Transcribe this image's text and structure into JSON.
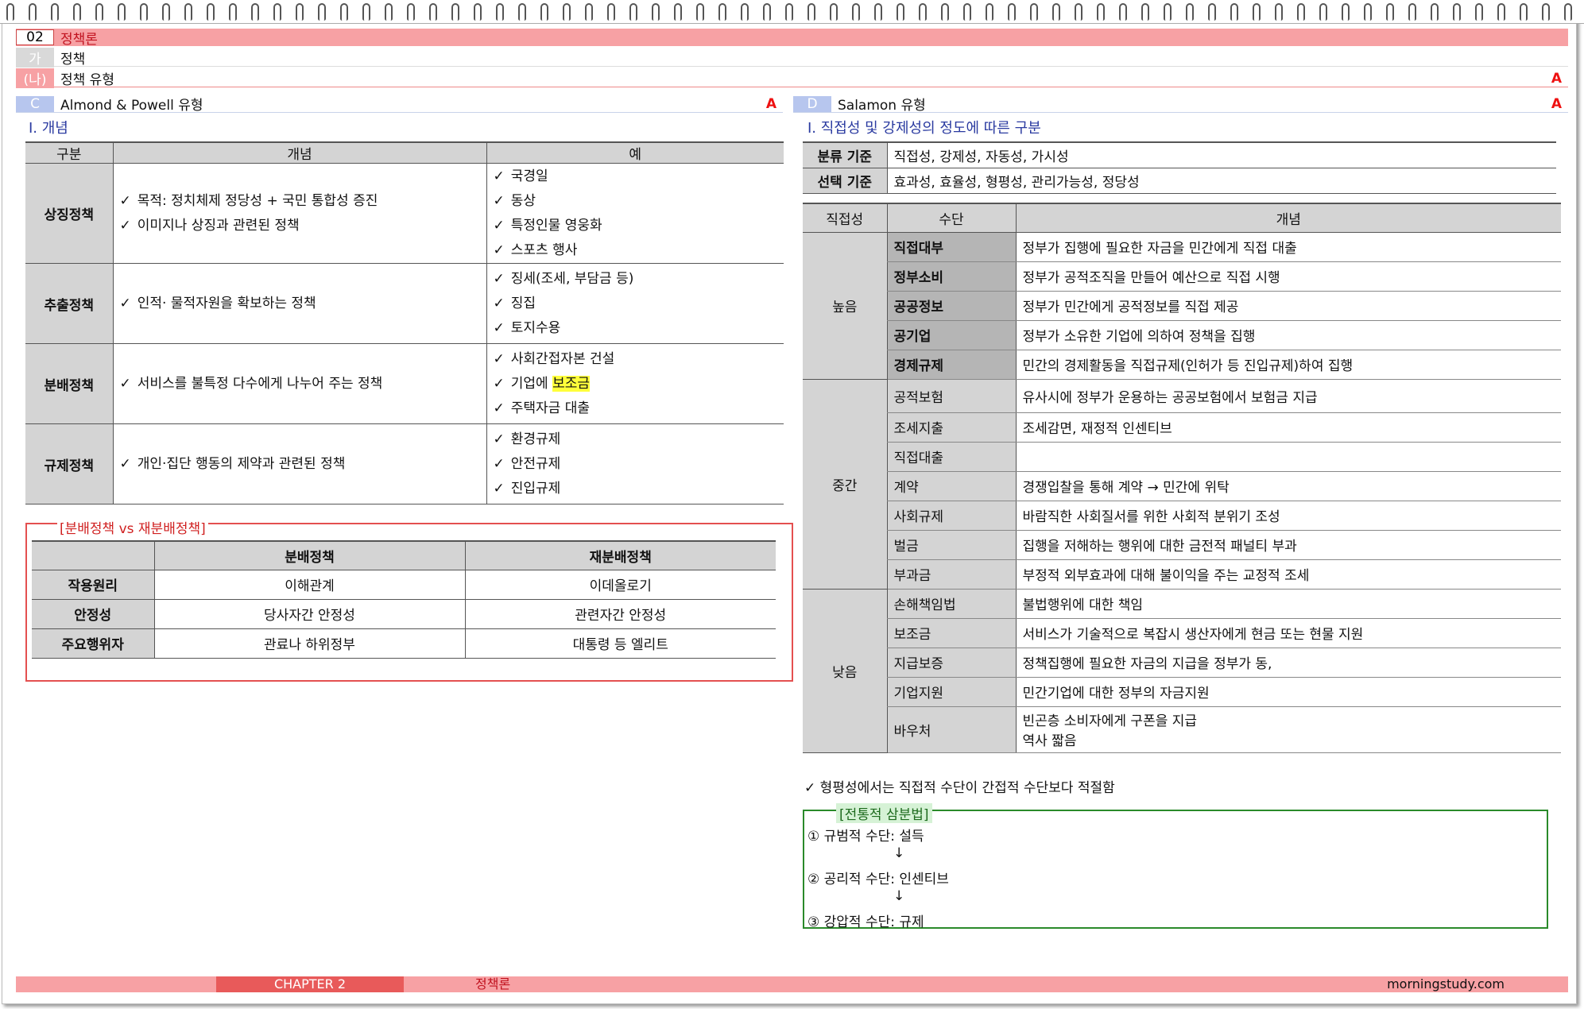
{
  "header": {
    "chapter_num": "02",
    "chapter_title": "정책론",
    "section_tag": "가",
    "section_title": "정책",
    "subsection_tag": "(나)",
    "subsection_title": "정책 유형",
    "subsection_grade": "A"
  },
  "left": {
    "tag": "C",
    "title": "Almond & Powell 유형",
    "grade": "A",
    "heading": "Ⅰ. 개념",
    "table": {
      "headers": [
        "구분",
        "개념",
        "예"
      ],
      "rows": [
        {
          "label": "상징정책",
          "concept": [
            "목적: 정치체제 정당성 + 국민 통합성 증진",
            "이미지나 상징과 관련된 정책"
          ],
          "examples": [
            "국경일",
            "동상",
            "특정인물 영웅화",
            "스포츠 행사"
          ]
        },
        {
          "label": "추출정책",
          "concept": [
            "인적· 물적자원을 확보하는 정책"
          ],
          "examples": [
            "징세(조세, 부담금 등)",
            "징집",
            "토지수용"
          ]
        },
        {
          "label": "분배정책",
          "concept": [
            "서비스를 불특정 다수에게 나누어 주는 정책"
          ],
          "examples": [
            "사회간접자본 건설",
            "기업에",
            "보조금",
            "주택자금 대출"
          ]
        },
        {
          "label": "규제정책",
          "concept": [
            "개인·집단 행동의 제약과 관련된 정책"
          ],
          "examples": [
            "환경규제",
            "안전규제",
            "진입규제"
          ]
        }
      ]
    },
    "compare": {
      "title": "[분배정책 vs 재분배정책]",
      "headers": [
        "",
        "분배정책",
        "재분배정책"
      ],
      "rows": [
        {
          "label": "작용원리",
          "a": "이해관계",
          "b": "이데올로기"
        },
        {
          "label": "안정성",
          "a": "당사자간 안정성",
          "b": "관련자간 안정성"
        },
        {
          "label": "주요행위자",
          "a": "관료나 하위정부",
          "b": "대통령 등 엘리트"
        }
      ]
    }
  },
  "right": {
    "tag": "D",
    "title": "Salamon 유형",
    "grade": "A",
    "heading": "Ⅰ. 직접성 및 강제성의 정도에 따른 구분",
    "criteria": [
      {
        "label": "분류 기준",
        "value": "직접성, 강제성, 자동성, 가시성"
      },
      {
        "label": "선택 기준",
        "value": "효과성, 효율성, 형평성, 관리가능성, 정당성"
      }
    ],
    "table": {
      "headers": [
        "직접성",
        "수단",
        "개념"
      ],
      "groups": [
        {
          "label": "높음",
          "rows": [
            {
              "means": "직접대부",
              "concept": "정부가 집행에 필요한 자금을 민간에게 직접 대출"
            },
            {
              "means": "정부소비",
              "concept": "정부가 공적조직을 만들어 예산으로 직접 시행"
            },
            {
              "means": "공공정보",
              "concept": "정부가 민간에게 공적정보를 직접 제공"
            },
            {
              "means": "공기업",
              "concept": "정부가 소유한 기업에 의하여 정책을 집행"
            },
            {
              "means": "경제규제",
              "concept": "민간의 경제활동을 직접규제(인허가 등 진입규제)하여 집행"
            }
          ]
        },
        {
          "label": "중간",
          "rows": [
            {
              "means": "공적보험",
              "concept": "유사시에 정부가 운용하는 공공보험에서 보험금 지급"
            },
            {
              "means": "조세지출",
              "concept": "조세감면, 재정적 인센티브"
            },
            {
              "means": "직접대출",
              "concept": ""
            },
            {
              "means": "계약",
              "concept": "경쟁입찰을 통해 계약 → 민간에 위탁"
            },
            {
              "means": "사회규제",
              "concept": "바람직한 사회질서를 위한 사회적 분위기 조성"
            },
            {
              "means": "벌금",
              "concept": "집행을 저해하는 행위에 대한 금전적 패널티 부과"
            },
            {
              "means": "부과금",
              "concept": "부정적 외부효과에 대해 불이익을 주는 교정적 조세"
            }
          ]
        },
        {
          "label": "낮음",
          "rows": [
            {
              "means": "손해책임법",
              "concept": "불법행위에 대한 책임"
            },
            {
              "means": "보조금",
              "concept": "서비스가 기술적으로 복잡시 생산자에게 현금 또는 현물 지원"
            },
            {
              "means": "지급보증",
              "concept": "정책집행에 필요한 자금의 지급을 정부가 동,"
            },
            {
              "means": "기업지원",
              "concept": "민간기업에 대한 정부의 자금지원"
            },
            {
              "means": "바우처",
              "concept": "빈곤층 소비자에게 구폰을 지급",
              "concept2": "역사 짧음"
            }
          ]
        }
      ]
    },
    "note": "형평성에서는 직접적 수단이 간접적 수단보다 적절함",
    "trad": {
      "title": "[전통적 삼분법]",
      "lines": [
        "① 규범적 수단: 설득",
        "↓",
        "② 공리적 수단: 인센티브",
        "↓",
        "③ 강압적 수단: 규제"
      ]
    }
  },
  "footer": {
    "chapter": "CHAPTER 2",
    "title": "정책론",
    "site": "morningstudy.com"
  },
  "colors": {
    "pink": "#f7a1a4",
    "red": "#e85a5a",
    "blue_tag": "#b7c6ee",
    "green": "#2a8a2a",
    "gray": "#d4d4d4"
  }
}
